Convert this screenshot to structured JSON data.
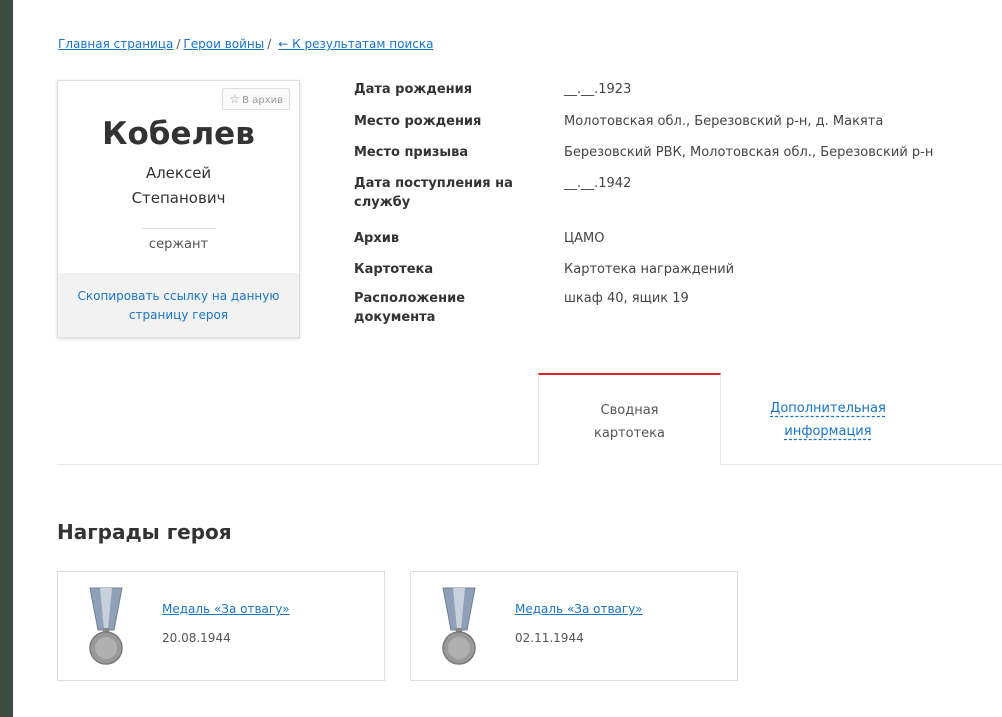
{
  "breadcrumb": {
    "home": "Главная страница",
    "section": "Герои войны",
    "back": "← К результатам поиска"
  },
  "hero": {
    "archive_button": "В архив",
    "surname": "Кобелев",
    "first_name": "Алексей",
    "patronymic": "Степанович",
    "rank": "сержант",
    "copy_link": "Скопировать ссылку на данную страницу героя"
  },
  "details": [
    {
      "label": "Дата рождения",
      "value": "__.__.1923"
    },
    {
      "label": "Место рождения",
      "value": "Молотовская обл., Березовский р-н, д. Макята"
    },
    {
      "label": "Место призыва",
      "value": "Березовский РВК, Молотовская обл., Березовский р-н"
    },
    {
      "label": "Дата поступления на службу",
      "value": "__.__.1942"
    },
    {
      "label": "Архив",
      "value": "ЦАМО"
    },
    {
      "label": "Картотека",
      "value": "Картотека награждений"
    },
    {
      "label": "Расположение документа",
      "value": "шкаф 40, ящик 19"
    }
  ],
  "tabs": {
    "active": "Сводная картотека",
    "other": "Дополнительная информация"
  },
  "awards": {
    "title": "Награды героя",
    "items": [
      {
        "name": "Медаль «За отвагу»",
        "date": "20.08.1944"
      },
      {
        "name": "Медаль «За отвагу»",
        "date": "02.11.1944"
      }
    ]
  },
  "colors": {
    "link": "#1a73c7",
    "tab_accent": "#e0232b",
    "outer_background": "#3a4d40"
  }
}
